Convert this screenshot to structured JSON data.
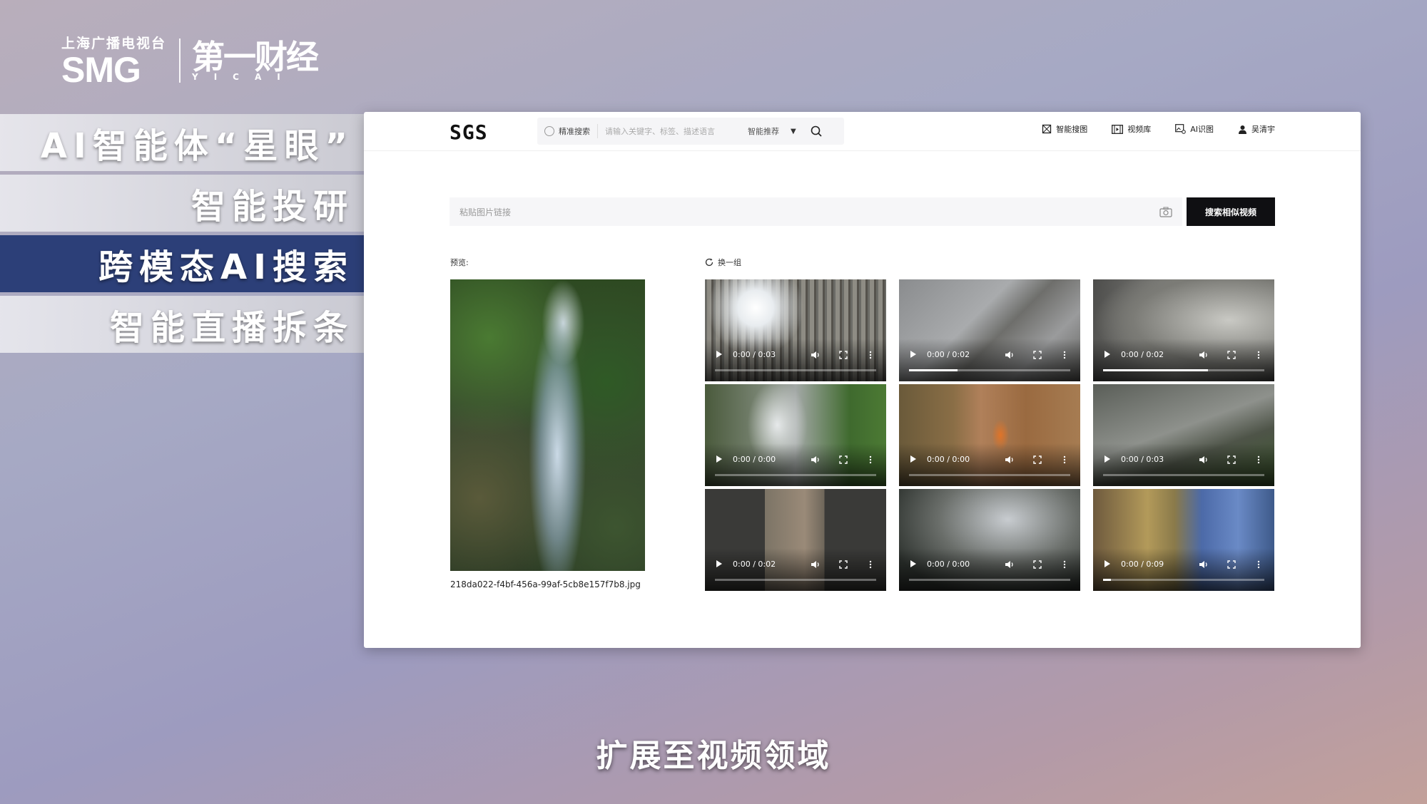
{
  "logo": {
    "smg_sub": "上海广播电视台",
    "smg": "SMG",
    "yicai": "第一财经",
    "yicai_sub": "YICAI"
  },
  "menu": [
    {
      "label": "AI智能体“星眼”"
    },
    {
      "label": "智能投研"
    },
    {
      "label": "跨模态AI搜索"
    },
    {
      "label": "智能直播拆条"
    }
  ],
  "app": {
    "brand": "SGS",
    "search": {
      "exact_label": "精准搜索",
      "placeholder": "请输入关键字、标签、描述语言",
      "mode": "智能推荐"
    },
    "nav": [
      {
        "label": "智能搜图",
        "icon": "image-search-icon"
      },
      {
        "label": "视频库",
        "icon": "film-icon"
      },
      {
        "label": "AI识图",
        "icon": "ai-image-icon"
      },
      {
        "label": "吴清宇",
        "icon": "user-icon"
      }
    ],
    "url_placeholder": "粘贴图片链接",
    "search_similar": "搜索相似视频",
    "preview_label": "预览:",
    "refresh_label": "换一组",
    "filename": "218da022-f4bf-456a-99af-5cb8e157f7b8.jpg",
    "videos": [
      {
        "time": "0:00 / 0:03",
        "progress": 0
      },
      {
        "time": "0:00 / 0:02",
        "progress": 0.3
      },
      {
        "time": "0:00 / 0:02",
        "progress": 0.65
      },
      {
        "time": "0:00 / 0:00",
        "progress": 0
      },
      {
        "time": "0:00 / 0:00",
        "progress": 0
      },
      {
        "time": "0:00 / 0:03",
        "progress": 0
      },
      {
        "time": "0:00 / 0:02",
        "progress": 0
      },
      {
        "time": "0:00 / 0:00",
        "progress": 0
      },
      {
        "time": "0:00 / 0:09",
        "progress": 0.05
      }
    ]
  },
  "subtitle": "扩展至视频领域"
}
